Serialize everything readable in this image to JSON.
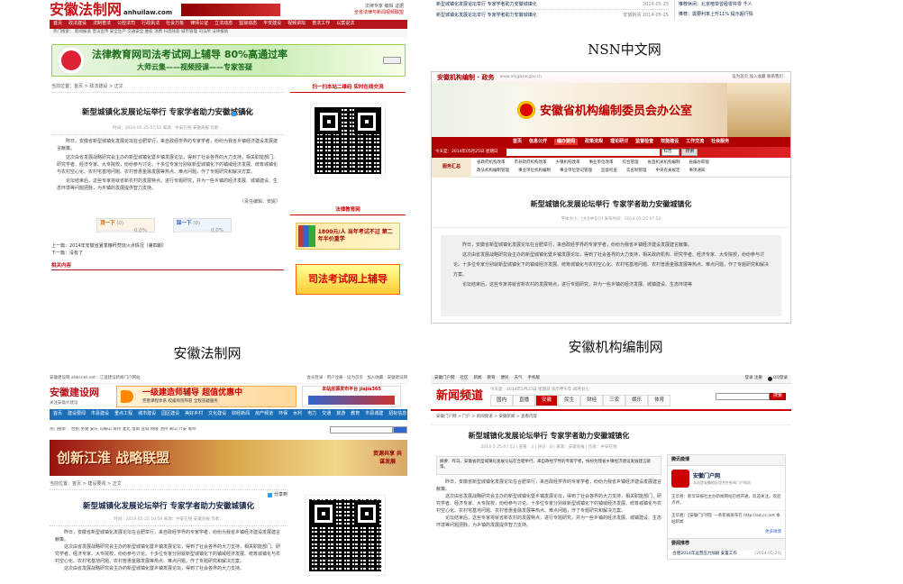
{
  "p1": {
    "logo": "安徽法制网",
    "domain": "anhuilaw.com",
    "top_links": "法律专家  编辑 证据",
    "top_tag": "全省法律与新闻视频联盟",
    "nav": [
      "首页",
      "政法建设",
      "法制普法",
      "公检法司",
      "行政执法",
      "社会万象",
      "律师公证",
      "立法动态",
      "监狱动态",
      "平安建设",
      "视频讲坛",
      "普法工作",
      "以案说法"
    ],
    "hot": "热门搜索：  新闻报道  普法宣传  安全生产  交通安全  维权  消费  扫黑除恶  城市管理  司法所  法律援助",
    "banner": "法律教育网司法考试网上辅导  80%高通过率",
    "banner_sub": "大师云集——视频授课——专家答疑",
    "breadcrumb": "当前位置：首页 > 政法建设 > 正文",
    "title": "新型城镇化发展论坛举行  专家学者助力安徽城镇化",
    "meta": "时间：2014-05-25 07:52  来源：中安在线-安徽商报  作者：",
    "share": "分享到",
    "p1": "昨日，安徽省新型城镇化发展论坛在合肥举行，来自政经学界的专家学者，纷纷为我省乡镇经济建设发展建言献策。",
    "p2": "这次由省发展战略研究会主办的新型城镇化暨乡镇发展论坛，得到了社会各界的大力支持，相关职能部门、研究学者、经济专家、大专院校，纷纷参与讨论。十多位专家分别就新型城镇化下的镇域经济发展、统筹城镇化与农村空心化、农村宅基地问题、农村普惠金融发展等热点、难点问题，作了专题研究和解决方案。",
    "p3": "论坛结束后，这些专家将就省新农村的发展特点，进行专题研究，并为一些乡镇的经济发展、城镇建设、生态环境等问题把脉，为乡镇的发展提供智力支持。",
    "editor": "（责任编辑：安妮）",
    "vote_up": "顶一下",
    "vote_up_n": "(0)",
    "vote_up_pct": "0.0%",
    "vote_down": "踩一下",
    "vote_down_n": "(0)",
    "vote_down_pct": "0.0%",
    "prev": "上一篇：2014年安徽省夏季粮秆焚烧火点情况（第四期）",
    "next": "下一篇：没有了",
    "related": "相关内容",
    "qr_title": "扫一扫本站二维码  实时在线交流",
    "ad_title": "法律教育网",
    "ad1": "1800元/人  当年考试不过  第二年半价重学",
    "ad2": "司法考试网上辅导"
  },
  "p2": {
    "news1": "新型城镇化发展论坛举行 专家学者助力安徽城镇化",
    "news1_date": "2014-05-25",
    "news2": "新型城镇化发展论坛举行 专家学者助力安徽城镇化",
    "news2_date": "安徽新闻  2014-05-25",
    "r1": "推荐休闲：北京榜单曾经零并零  千人",
    "r2": "推荐：需要利率上升11% 提示超行情"
  },
  "cap_nsn": "NSN中文网",
  "p3": {
    "site": "安徽机构编制 · 政务",
    "url": "www.ahjgbzw.gov.cn",
    "toplinks": "设为首页  加入收藏  联系我们",
    "title": "安徽省机构编制委员会办公室",
    "nav": [
      "首页",
      "信息公开",
      "编办要闻",
      "政策法规",
      "理论研讨",
      "监督检查",
      "效能建设",
      "工作交流",
      "社会服务"
    ],
    "date_bar": "今天是：2014年05月25日 星期日",
    "search_btn": "搜索",
    "options": "科普",
    "cat_label": "服务汇总",
    "cats": [
      "省政府机构改革",
      "市县政府机构改革",
      "乡镇机构改革",
      "事业单位改革",
      "综合管理",
      "省直机关机构编制",
      "省编办职能"
    ],
    "cats2": [
      "政法机构编制管理",
      "事业单位机构编制",
      "事业单位登记管理",
      "监督检查",
      "实名制管理",
      "中央有关规定",
      "事项通知"
    ],
    "article_title": "新型城镇化发展论坛举行  专家学者助力安徽城镇化",
    "meta": "字体大小：[大][中][小]    发布时间：2014-05-25 07:52",
    "p1": "昨日，安徽省新型城镇化发展论坛在合肥举行，来自政经学界的专家学者，纷纷为我省乡镇经济建设发展建言献策。",
    "p2": "这次由省发展战略研究会主办的新型城镇化暨乡镇发展论坛，得到了社会各界的大力支持，相关政府机构、研究学者、经济专家、大专院校，纷纷参与讨论。十多位专家分别就新型城镇化下的镇域经济发展、统筹城镇化与农村空心化、农村宅基地问题、农村普惠金融发展等热点、难点问题，作了专题研究和解决方案。",
    "p3": "论坛结束后，这些专家将就省新农村的发展特点，进行专题研究，并为一些乡镇的经济发展、城镇建设、生态环境等"
  },
  "cap_law": "安徽法制网",
  "cap_bz": "安徽机构编制网",
  "p4": {
    "top": "安徽建设网 ahbsnet.net：江淮建设新闻门户网站",
    "top_right": "会员登录 · 用户注册 · 设为首页 · 加入收藏 · 安徽建设网",
    "logo": "安徽建设网",
    "logo_sub": "关注安徽大建设",
    "ad": "一级建造师辅导  超值优惠中",
    "ad_sub": "完善课程体系 权威师资阵容 全程答疑服务",
    "ad2": "本站房源发布平台  jiajia365",
    "nav": [
      "首页",
      "建设要闻",
      "市县建设",
      "重点工程",
      "城市建设",
      "园区建设",
      "美好乡村",
      "文化建设",
      "财经新闻",
      "房产频道",
      "环保",
      "水利",
      "电力",
      "交通",
      "旅游",
      "教育",
      "市县城建",
      "招标信息"
    ],
    "hot": "热门搜索：  合肥  芜湖  安庆  马鞍山  滁州  淮北  淮南  宣城  铜陵  池州  黄山  六安  亳州",
    "banner": "创新江淮  战略联盟",
    "banner_right": "资源共享  共谋发展",
    "breadcrumb": "当前位置：首页 > 建设要闻 > 正文",
    "title": "新型城镇化发展论坛举行  专家学者助力安徽城镇化",
    "meta": "时间：2014-05-25 10:59  来源：中安在线-安徽商报  作者：",
    "share": "分享到",
    "p1": "昨日，安徽省新型城镇化发展论坛在合肥举行，来自政经学界的专家学者，纷纷为我省乡镇经济建设发展建言献策。",
    "p2": "这次由省发展战略研究会主办的新型城镇化暨乡镇发展论坛，得到了社会各界的大力支持，相关职能部门、研究学者、经济专家、大专院校，纷纷参与讨论。十多位专家分别就新型城镇化下的镇域经济发展、统筹城镇化与农村空心化、农村宅基地问题、农村普惠金融发展等热点、难点问题，作了专题研究和解决方案。",
    "p3": "这次由省发展战略研究会主办的新型城镇化暨乡镇发展论坛，得到了社会各界的大力支持。"
  },
  "p5": {
    "topnav": [
      "安徽门户网",
      "社区",
      "新闻",
      "教育",
      "便民",
      "天气",
      "手机版"
    ],
    "toplinks": "登录  注册",
    "qq": "QQ登录",
    "logo": "新闻频道",
    "date": "今天是：2014年5月25日 星期日  农历甲午年  四月廿七",
    "nav": [
      "国内",
      "直播",
      "安徽",
      "民生",
      "财经",
      "三农",
      "娱乐",
      "体育"
    ],
    "search_btn": "搜索",
    "breadcrumb": "安徽门户网 > 门户 > 新闻频道 > 安徽新闻 > 查看内容",
    "title": "新型城镇化发展论坛举行 专家学者助力安徽城镇化",
    "meta": "2014-5-25 07:52  | 查看：3  | 评论：0  | 来源：安徽商报  | 作者：中安在线",
    "summary": "摘要：昨日，安徽省新型城镇化发展论坛在合肥举行，来自政经学界的专家学者，纷纷为我省乡镇经济建设发展建言献策。",
    "p1": "昨日，安徽省新型城镇化发展论坛在合肥举行，来自政经学界的专家学者，纷纷为我省乡镇经济建设发展建言献策。",
    "p2": "这次由省发展战略研究会主办的新型城镇化暨乡镇发展论坛，得到了社会各界的大力支持，相关职能部门、研究学者、经济专家、大专院校，纷纷参与讨论。十多位专家分别就新型城镇化下的镇域经济发展、统筹城镇化与农村空心化、农村宅基地问题、农村普惠金融发展等热点、难点问题，作了专题研究和解决方案。",
    "p3": "论坛结束后，这些专家将就省新农村的发展特点，进行专题研究，并为一些乡镇的经济发展、城镇建设、生态环境等问题把脉，为乡镇的发展提供智力支持。",
    "side_title": "腾讯微博",
    "side_name": "安徽门户网",
    "side_desc": "本站是安徽地区综合性新闻门户网站",
    "comment1": "王华君：新华日报社主办新闻网站已经开通，欢迎关注，欢迎点评。",
    "comment2": "王华君：【安徽门户网】一条新闻发布在 http://ad.cc.net  本站新闻",
    "side_more": "更多微博",
    "recommend": "要闻推荐",
    "rec1": "·合肥2014年运营压力加剧  安置工作",
    "rec1_date": "[2014-05-24]"
  }
}
